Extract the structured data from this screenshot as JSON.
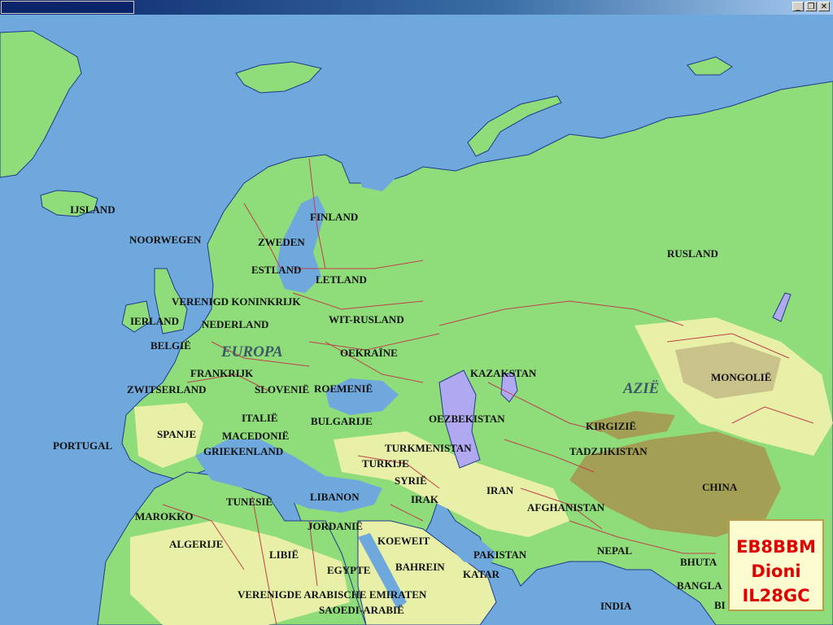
{
  "window": {
    "buttons": [
      {
        "name": "minimize",
        "glyph": "_"
      },
      {
        "name": "restore",
        "glyph": "❐"
      },
      {
        "name": "close",
        "glyph": "✕"
      }
    ]
  },
  "map": {
    "regions": {
      "europe": "EUROPA",
      "asia": "AZIË"
    },
    "countries": {
      "ijsland": "IJSLAND",
      "noorwegen": "NOORWEGEN",
      "zweden": "ZWEDEN",
      "finland": "FINLAND",
      "estland": "ESTLAND",
      "letland": "LETLAND",
      "verenigd_koninkrijk": "VERENIGD KONINKRIJK",
      "ierland": "IERLAND",
      "nederland": "NEDERLAND",
      "wit_rusland": "WIT-RUSLAND",
      "belgie": "BELGIË",
      "oekraine": "OEKRAÏNE",
      "frankrijk": "FRANKRIJK",
      "zwitserland": "ZWITSERLAND",
      "slovenie": "SLOVENIË",
      "roemenie": "ROEMENIË",
      "italie": "ITALIË",
      "bulgarije": "BULGARIJE",
      "spanje": "SPANJE",
      "macedonie": "MACEDONIË",
      "portugal": "PORTUGAL",
      "griekenland": "GRIEKENLAND",
      "turkmenistan": "TURKMENISTAN",
      "turkije": "TURKIJE",
      "syrie": "SYRIË",
      "tunesie": "TUNESIË",
      "libanon": "LIBANON",
      "irak": "IRAK",
      "iran": "IRAN",
      "marokko": "MAROKKO",
      "jordanie": "JORDANIË",
      "algerije": "ALGERIJE",
      "koeweit": "KOEWEIT",
      "libie": "LIBIË",
      "egypte": "EGYPTE",
      "bahrein": "BAHREIN",
      "katar": "KATAR",
      "vae": "VERENIGDE ARABISCHE EMIRATEN",
      "saoedi": "SAOEDI-ARABIË",
      "rusland": "RUSLAND",
      "kazakstan": "KAZAKSTAN",
      "oezbekistan": "OEZBEKISTAN",
      "kirgizie": "KIRGIZIË",
      "tadzjikistan": "TADZJIKISTAN",
      "mongolie": "MONGOLIË",
      "china": "CHINA",
      "afghanistan": "AFGHANISTAN",
      "pakistan": "PAKISTAN",
      "nepal": "NEPAL",
      "india": "INDIA",
      "bhutan_cut": "BHUTA",
      "bangla_cut": "BANGLA",
      "bi_cut": "BI"
    },
    "colors": {
      "sea": "#6fa8dc",
      "lowland": "#8fdc7a",
      "upland": "#e8f0a8",
      "highland": "#a3a055",
      "lake": "#b0a8f0",
      "border": "#c0404a"
    }
  },
  "station": {
    "callsign": "EB8BBM",
    "name": "Dioni",
    "locator": "IL28GC"
  }
}
